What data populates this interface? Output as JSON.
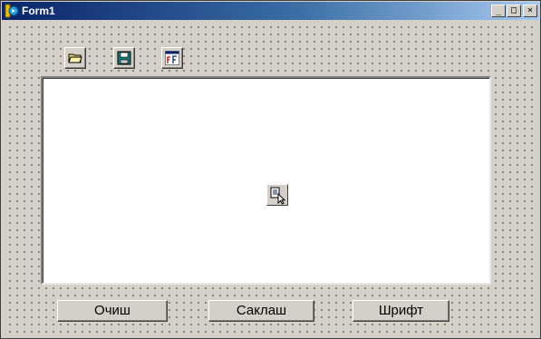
{
  "window": {
    "title": "Form1",
    "controls": {
      "minimize": "_",
      "maximize": "□",
      "close": "×"
    }
  },
  "toolbar": {
    "items": [
      {
        "name": "open",
        "icon": "open-folder-icon"
      },
      {
        "name": "save",
        "icon": "floppy-disk-icon"
      },
      {
        "name": "font",
        "icon": "font-dialog-icon"
      }
    ]
  },
  "memo": {
    "text": ""
  },
  "nonvisual_component": {
    "icon": "open-dialog-component-icon"
  },
  "buttons": {
    "clear_label": "Очиш",
    "save_label": "Саклаш",
    "font_label": "Шрифт"
  },
  "colors": {
    "title_gradient_start": "#0a246a",
    "title_gradient_end": "#a6caf0",
    "face": "#d4d0c8",
    "memo_background": "#ffffff"
  }
}
